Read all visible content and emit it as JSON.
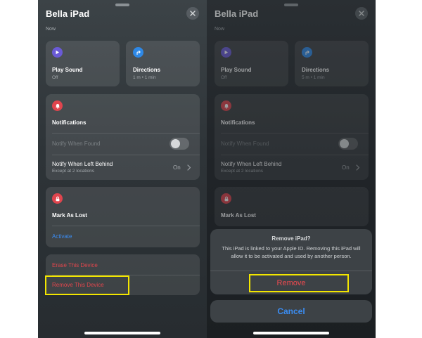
{
  "left": {
    "device_name": "Bella iPad",
    "subtitle": "Now",
    "play_sound": {
      "label": "Play Sound",
      "sub": "Off"
    },
    "directions": {
      "label": "Directions",
      "sub": "1 m • 1 min"
    },
    "notifications": {
      "title": "Notifications",
      "notify_found": "Notify When Found",
      "notify_left_behind": "Notify When Left Behind",
      "left_behind_sub": "Except at 2 locations",
      "left_behind_value": "On"
    },
    "lost": {
      "title": "Mark As Lost",
      "action": "Activate"
    },
    "erase": "Erase This Device",
    "remove": "Remove This Device"
  },
  "right": {
    "device_name": "Bella iPad",
    "subtitle": "Now",
    "play_sound": {
      "label": "Play Sound",
      "sub": "Off"
    },
    "directions": {
      "label": "Directions",
      "sub": "5 m • 1 min"
    },
    "notifications": {
      "title": "Notifications",
      "notify_found": "Notify When Found",
      "notify_left_behind": "Notify When Left Behind",
      "left_behind_sub": "Except at 2 locations",
      "left_behind_value": "On"
    },
    "lost": {
      "title": "Mark As Lost"
    },
    "dialog": {
      "title": "Remove iPad?",
      "message": "This iPad is linked to your Apple ID. Removing this iPad will allow it to be activated and used by another person.",
      "remove": "Remove",
      "cancel": "Cancel"
    }
  },
  "colors": {
    "highlight": "#f3e600",
    "destructive": "#e2464c",
    "link": "#3b8cf0",
    "play_sound_icon": "#6a5ad6",
    "directions_icon": "#2e88e6",
    "notification_icon": "#e0454e"
  },
  "icons": [
    "close-icon",
    "play-icon",
    "directions-arrow-icon",
    "bell-icon",
    "lock-icon",
    "chevron-right-icon"
  ]
}
